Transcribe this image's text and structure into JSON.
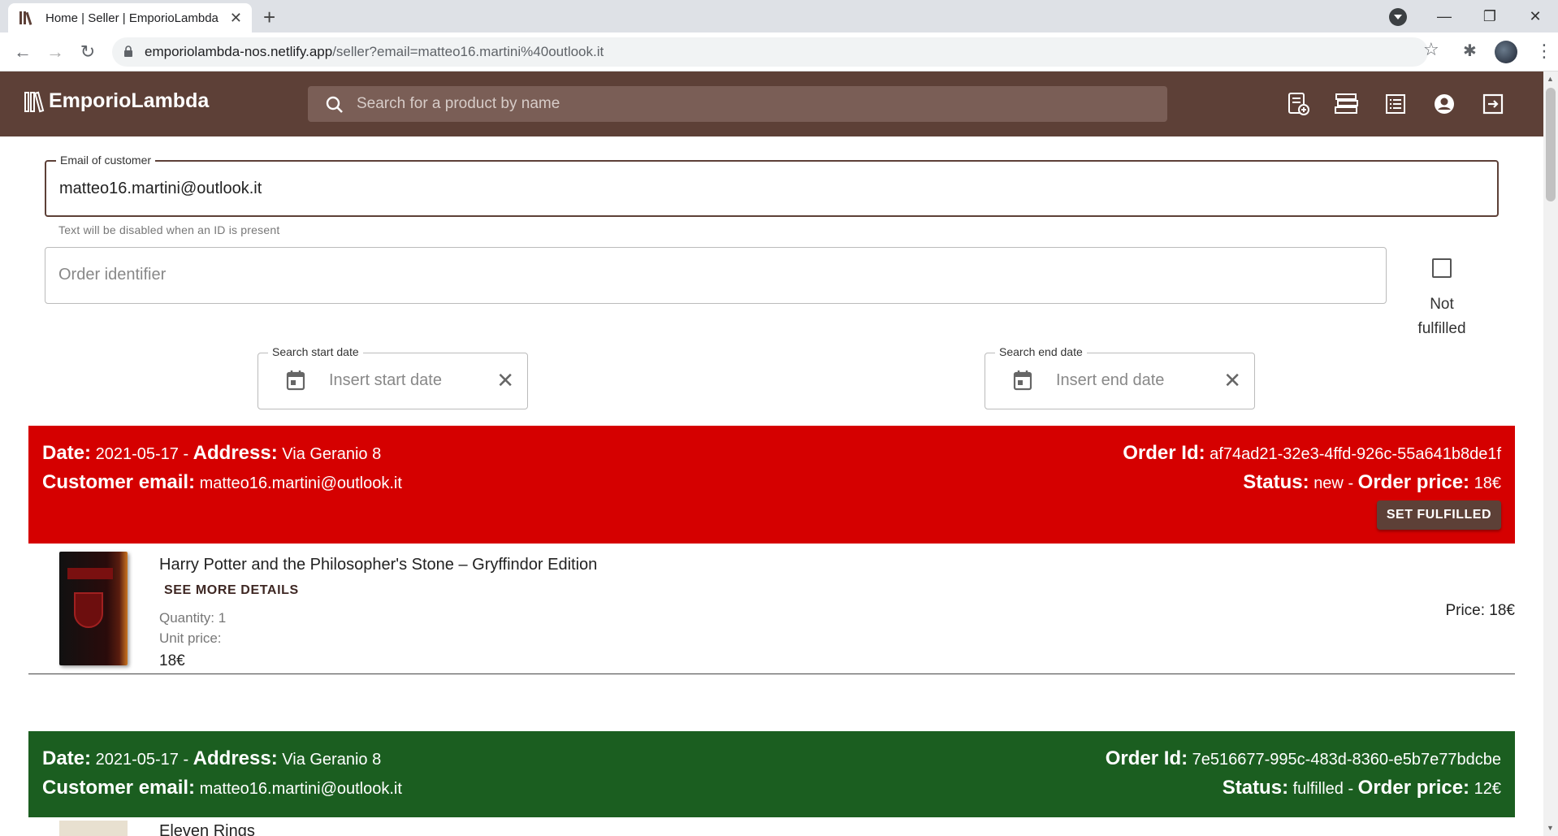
{
  "browser": {
    "tab_title": "Home | Seller | EmporioLambda",
    "url_host": "emporiolambda-nos.netlify.app",
    "url_path": "/seller?email=matteo16.martini%40outlook.it"
  },
  "app": {
    "brand": "EmporioLambda",
    "search_placeholder": "Search for a product by name",
    "header_icons": [
      "add-product-icon",
      "inventory-icon",
      "orders-list-icon",
      "account-icon",
      "logout-icon"
    ]
  },
  "filters": {
    "email_label": "Email of customer",
    "email_value": "matteo16.martini@outlook.it",
    "email_helper": "Text will be disabled when an ID is present",
    "order_id_placeholder": "Order identifier",
    "not_fulfilled_label_1": "Not",
    "not_fulfilled_label_2": "fulfilled",
    "start_label": "Search start date",
    "start_placeholder": "Insert start date",
    "end_label": "Search end date",
    "end_placeholder": "Insert end date"
  },
  "labels": {
    "date": "Date:",
    "address": "Address:",
    "customer_email": "Customer email:",
    "order_id": "Order Id:",
    "status": "Status:",
    "order_price": "Order price:",
    "sep": " - "
  },
  "orders": [
    {
      "date": "2021-05-17",
      "address": "Via Geranio 8",
      "customer_email": "matteo16.martini@outlook.it",
      "order_id": "af74ad21-32e3-4ffd-926c-55a641b8de1f",
      "status": "new",
      "order_price": "18€",
      "action": "SET FULFILLED",
      "color": "#d50000",
      "items": [
        {
          "title": "Harry Potter and the Philosopher's Stone – Gryffindor Edition",
          "details": "SEE MORE DETAILS",
          "quantity": "Quantity: 1",
          "unit_price_label": "Unit price:",
          "unit_price": "18€",
          "price": "Price: 18€"
        }
      ]
    },
    {
      "date": "2021-05-17",
      "address": "Via Geranio 8",
      "customer_email": "matteo16.martini@outlook.it",
      "order_id": "7e516677-995c-483d-8360-e5b7e77bdcbe",
      "status": "fulfilled",
      "order_price": "12€",
      "color": "#1b5e20",
      "items": [
        {
          "title": "Eleven Rings"
        }
      ]
    }
  ]
}
